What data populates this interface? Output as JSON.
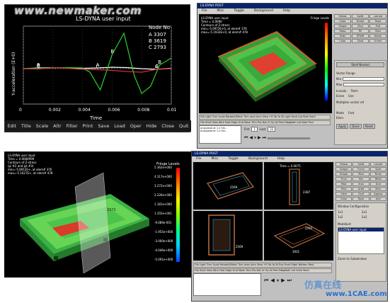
{
  "watermark": "www.newmaker.com",
  "chart_window": {
    "menu_items": [
      "Edit",
      "Title",
      "Scale",
      "Altr",
      "Filter",
      "Print",
      "Save",
      "Load",
      "Oper",
      "Hide",
      "Close",
      "Quit"
    ]
  },
  "chart_data": {
    "type": "line",
    "title": "LS-DYNA user input",
    "xlabel": "Time",
    "ylabel": "Y-acceleration (E+0)",
    "x_ticks": [
      "0",
      "0.002",
      "0.004",
      "0.006",
      "0.008",
      "0.01"
    ],
    "xlim": [
      0,
      0.01
    ],
    "legend_title": "Node No",
    "series": [
      {
        "name": "3307",
        "marker": "A",
        "color": "#ffffff",
        "x": [
          0,
          0.001,
          0.002,
          0.003,
          0.004,
          0.005,
          0.006,
          0.007,
          0.008,
          0.009,
          0.01
        ],
        "y": [
          0,
          0.02,
          0.03,
          0.02,
          0.01,
          0.02,
          0.04,
          0.03,
          0.0,
          -0.02,
          0.01
        ]
      },
      {
        "name": "3619",
        "marker": "B",
        "color": "#2bd12b",
        "x": [
          0,
          0.001,
          0.002,
          0.003,
          0.004,
          0.0045,
          0.0052,
          0.006,
          0.0068,
          0.0075,
          0.008,
          0.0086,
          0.0092,
          0.01
        ],
        "y": [
          0,
          0.01,
          0.02,
          0.03,
          0.02,
          -0.1,
          -0.6,
          0.4,
          1.0,
          -0.2,
          -0.7,
          -0.5,
          0.1,
          0.3
        ]
      },
      {
        "name": "2793",
        "marker": "C",
        "color": "#cc3333",
        "x": [
          0,
          0.001,
          0.002,
          0.003,
          0.004,
          0.005,
          0.006,
          0.007,
          0.008,
          0.009,
          0.01
        ],
        "y": [
          0,
          -0.01,
          0.03,
          0.01,
          -0.02,
          -0.03,
          -0.05,
          -0.08,
          -0.1,
          -0.02,
          0.0
        ]
      }
    ]
  },
  "post_window_1": {
    "title": "LS-DYNA POST",
    "menu": [
      "File",
      "Misc",
      "Toggle",
      "Background",
      "Help"
    ],
    "header_lines": [
      "LS-DYNA user input",
      "Time = 0.0090",
      "Contours of Z-stress",
      "min=-5.0972E+0, at elem# 376",
      "max=-5.1932E+0, at elem# 478"
    ],
    "fringe_title": "Fringe Levels",
    "side_buttons": [
      "Follow",
      "Splitt",
      "Lamod",
      "Color",
      "Dmod",
      "Tools",
      "Shape",
      "Sfcp",
      "Fort",
      "Mass",
      "Fill",
      "Mod",
      "Rdel",
      "ZFWR",
      "Name",
      "Color",
      "Dind",
      "Orient"
    ],
    "panel_fields": [
      "Shell Normal",
      "Vector Range",
      "Min",
      "Max",
      "Include",
      "Tstch",
      "Erase",
      "Use",
      "Multiplier vector ref",
      "Mode",
      "Fset",
      "Elem",
      "Apply",
      "Done",
      "Reset"
    ],
    "command_rows": [
      "File Light Trim Scale RotateX/Mesh Trim area Anm View +R 0b 0s Bi Light Nmd Aut Rest Solid",
      "File Shell View Wire Feat Edge Grid Mesh Trim Pro Dot /V Op All Pad EdbgBoth Lat Note Pcol"
    ],
    "status": [
      "Ansiglead at 1.0 Shl...",
      "Ansiglead at 1.0 Shl..."
    ],
    "frame_label": "Frst",
    "frame_value": "1",
    "last_label": "Last",
    "last_value": "22"
  },
  "fringe_window": {
    "header_lines": [
      "LS-DYNA user input",
      "Time = 0.0084999",
      "Contours of Z-stress",
      "(pi #2 and ipt #3)",
      "min=-5.8912E+, at elem# 376",
      "max=-5.1627E+, at elem# 478"
    ],
    "fringe_title": "Fringe Levels",
    "levels": [
      "5.362e+000",
      "4.317e+000",
      "3.272e+000",
      "2.226e+000",
      "1.181e+000",
      "1.355e+001",
      "-9.089e-001",
      "-1.955e+000",
      "-3.000e+000",
      "-4.046e+000",
      "-5.091e+000"
    ],
    "callout": "2372"
  },
  "post_window_2": {
    "title": "LS-DYNA POST",
    "menu": [
      "File",
      "Misc",
      "Toggle",
      "Background",
      "Help"
    ],
    "viewport_labels": [
      "Time = 0.0075",
      "2569",
      "2387",
      "2569",
      "2593",
      "3001"
    ],
    "side_buttons": [
      "Follow",
      "Splitt",
      "Lamod",
      "Output",
      "Fcmd",
      "Spht",
      "Shape",
      "Mod",
      "Nmst",
      "Tinvl",
      "Min",
      "Write",
      "Mod",
      "Xnol",
      "Dnd",
      "Plnd",
      "Arbit",
      "Wrnr",
      "View",
      "Gcof",
      "Approx",
      "Color",
      "Bpla",
      "Avsi"
    ],
    "window_config_title": "Window Configuration",
    "window_options": [
      "1x1",
      "2x1",
      "1x2",
      "2x2"
    ],
    "model_list_title": "ModelList",
    "model_list_item": "LS-DYNA user input",
    "zoom_title": "Zoom to Subwindow",
    "command_rows": [
      "File Light Trim Scale RotateX/Mesh Trim area Anm View +R 0b 0s Bi Ecp Front Right Bottom Rest",
      "File Shell View Wire Feat Edge Grid Mesh Trim Pro Dot /V Op All Pad EdbgBoth Lat Anim Nmd"
    ]
  },
  "logo_text": "仿真在线",
  "logo_sub": "www.1CAE.com",
  "colors": {
    "title_blue": "#0a246a",
    "chart_bg": "#000000",
    "panel_gray": "#c0c0c0"
  }
}
